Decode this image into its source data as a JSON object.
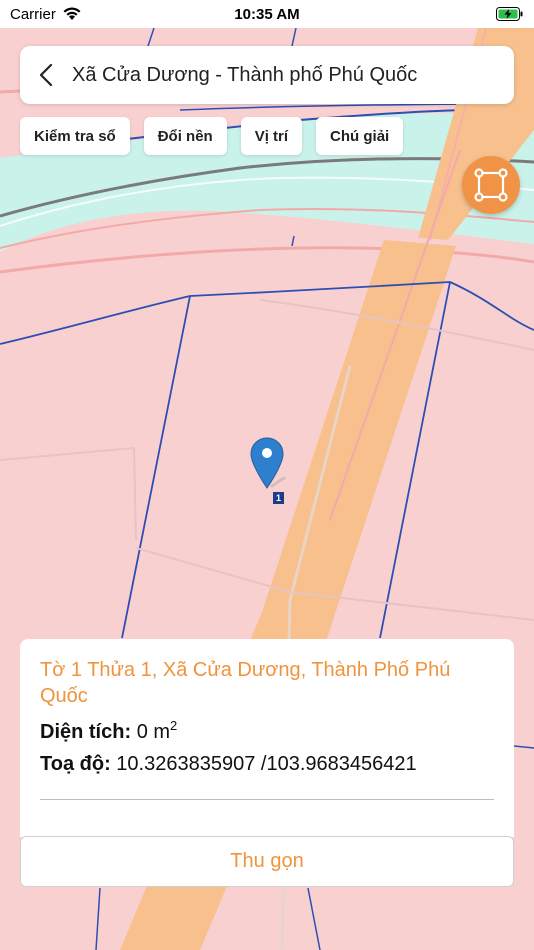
{
  "status_bar": {
    "carrier": "Carrier",
    "time": "10:35 AM"
  },
  "header": {
    "title": "Xã Cửa Dương - Thành phố Phú Quốc"
  },
  "chips": [
    {
      "label": "Kiểm tra sổ"
    },
    {
      "label": "Đổi nền"
    },
    {
      "label": "Vị trí"
    },
    {
      "label": "Chú giải"
    }
  ],
  "map": {
    "parcel_number": "1"
  },
  "info": {
    "title": "Tờ 1 Thửa 1, Xã Cửa Dương, Thành Phố Phú Quốc",
    "area_label": "Diện tích:",
    "area_value": "0 m",
    "area_unit_exp": "2",
    "coord_label": "Toạ độ:",
    "coord_value": "10.3263835907 /103.9683456421"
  },
  "collapse_button": {
    "label": "Thu gọn"
  },
  "colors": {
    "accent": "#f09347",
    "land_pink": "#f9d0d0",
    "road_orange": "#f7c08c",
    "water_cyan": "#c9f2ea",
    "boundary_blue": "#2d4fb3"
  }
}
